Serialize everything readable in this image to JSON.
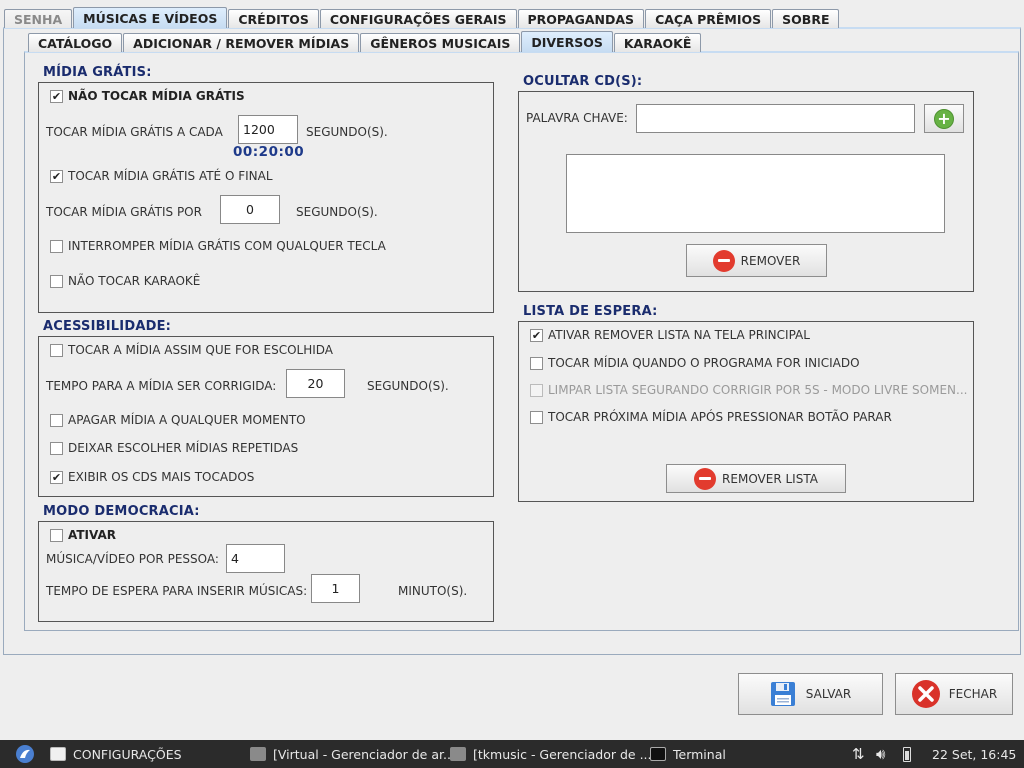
{
  "tabs": [
    {
      "label": "SENHA",
      "state": "disabled"
    },
    {
      "label": "MÚSICAS E VÍDEOS",
      "state": "selected"
    },
    {
      "label": "CRÉDITOS",
      "state": "normal"
    },
    {
      "label": "CONFIGURAÇÕES GERAIS",
      "state": "normal"
    },
    {
      "label": "PROPAGANDAS",
      "state": "normal"
    },
    {
      "label": "CAÇA PRÊMIOS",
      "state": "normal"
    },
    {
      "label": "SOBRE",
      "state": "normal"
    }
  ],
  "subtabs": [
    {
      "label": "CATÁLOGO",
      "state": "normal"
    },
    {
      "label": "ADICIONAR / REMOVER MÍDIAS",
      "state": "normal"
    },
    {
      "label": "GÊNEROS MUSICAIS",
      "state": "normal"
    },
    {
      "label": "DIVERSOS",
      "state": "selected"
    },
    {
      "label": "KARAOKÊ",
      "state": "normal"
    }
  ],
  "midia_gratis": {
    "title": "MÍDIA GRÁTIS:",
    "nao_tocar": {
      "label": "NÃO TOCAR MÍDIA GRÁTIS",
      "checked": true
    },
    "tocar_a_cada_label": "TOCAR MÍDIA GRÁTIS A CADA",
    "tocar_a_cada_value": "1200",
    "segundos_1": "SEGUNDO(S).",
    "time_display": "00:20:00",
    "ate_final": {
      "label": "TOCAR MÍDIA GRÁTIS ATÉ O FINAL",
      "checked": true
    },
    "tocar_por_label": "TOCAR MÍDIA GRÁTIS POR",
    "tocar_por_value": "0",
    "segundos_2": "SEGUNDO(S).",
    "interromper": {
      "label": "INTERROMPER MÍDIA GRÁTIS COM QUALQUER TECLA",
      "checked": false
    },
    "nao_karaoke": {
      "label": "NÃO TOCAR KARAOKÊ",
      "checked": false
    }
  },
  "acessibilidade": {
    "title": "ACESSIBILIDADE:",
    "tocar_escolhida": {
      "label": "TOCAR A MÍDIA ASSIM QUE FOR ESCOLHIDA",
      "checked": false
    },
    "tempo_label": "TEMPO PARA A MÍDIA SER CORRIGIDA:",
    "tempo_value": "20",
    "segundos": "SEGUNDO(S).",
    "apagar": {
      "label": "APAGAR MÍDIA A QUALQUER MOMENTO",
      "checked": false
    },
    "repetidas": {
      "label": "DEIXAR ESCOLHER MÍDIAS REPETIDAS",
      "checked": false
    },
    "exibir_cds": {
      "label": "EXIBIR OS CDS MAIS TOCADOS",
      "checked": true
    }
  },
  "democracia": {
    "title": "MODO DEMOCRACIA:",
    "ativar": {
      "label": "ATIVAR",
      "checked": false
    },
    "por_pessoa_label": "MÚSICA/VÍDEO POR PESSOA:",
    "por_pessoa_value": "4",
    "espera_label": "TEMPO DE ESPERA PARA INSERIR MÚSICAS:",
    "espera_value": "1",
    "minutos": "MINUTO(S)."
  },
  "ocultar": {
    "title": "OCULTAR CD(S):",
    "palavra_label": "PALAVRA CHAVE:",
    "palavra_value": "",
    "remover_label": "REMOVER"
  },
  "lista_espera": {
    "title": "LISTA DE ESPERA:",
    "ativar_remover": {
      "label": "ATIVAR REMOVER LISTA NA TELA PRINCIPAL",
      "checked": true
    },
    "tocar_iniciado": {
      "label": "TOCAR MÍDIA QUANDO O PROGRAMA FOR INICIADO",
      "checked": false
    },
    "limpar": {
      "label": "LIMPAR LISTA SEGURANDO CORRIGIR POR 5S - MODO LIVRE SOMEN...",
      "checked": false,
      "disabled": true
    },
    "proxima": {
      "label": "TOCAR PRÓXIMA MÍDIA APÓS PRESSIONAR BOTÃO PARAR",
      "checked": false
    },
    "remover_lista_label": "REMOVER LISTA"
  },
  "footer": {
    "salvar": "SALVAR",
    "fechar": "FECHAR"
  },
  "taskbar": {
    "items": [
      "CONFIGURAÇÕES",
      "[Virtual - Gerenciador de ar...",
      "[tkmusic - Gerenciador de ...",
      "Terminal"
    ],
    "clock": "22 Set, 16:45"
  },
  "colors": {
    "title_blue": "#1a2c6e",
    "selected_tab": "#c6dcf2",
    "remove_red": "#e23b2e",
    "add_green": "#67b245"
  }
}
